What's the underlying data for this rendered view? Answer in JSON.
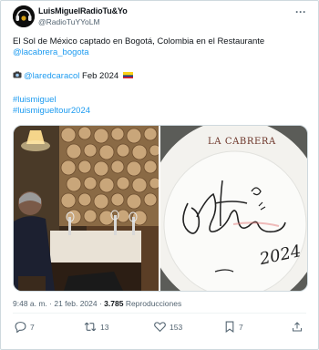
{
  "author": {
    "display_name": "LuisMiguelRadioTu&Yo",
    "handle": "@RadioTuYYoLM",
    "avatar_icon": "microphone-icon"
  },
  "tweet": {
    "text_line1": "El Sol de México captado en Bogotá,  Colombia en el Restaurante",
    "text_line2": "@lacabrera_bogota",
    "credit_handle": "@laredcaracol",
    "credit_date": "Feb 2024",
    "hashtag1": "#luismiguel",
    "hashtag2": "#luismigueltour2024"
  },
  "media": {
    "right_photo_text": "LA CABRERA",
    "signature_year": "2024"
  },
  "meta": {
    "time_date": "9:48 a. m. · 21 feb. 2024 · ",
    "views_count": "3.785",
    "views_label": " Reproducciones"
  },
  "actions": {
    "replies": "7",
    "retweets": "13",
    "likes": "153",
    "bookmarks": "7"
  },
  "colors": {
    "link": "#1d9bf0",
    "secondary_text": "#536471"
  }
}
